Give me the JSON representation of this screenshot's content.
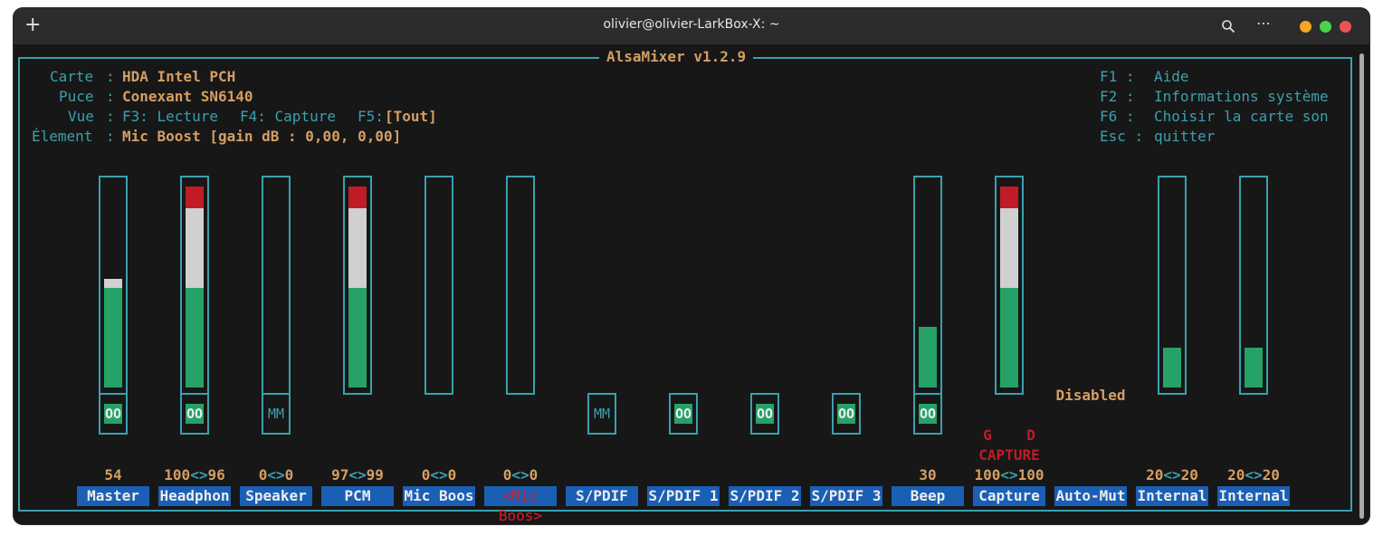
{
  "window": {
    "title": "olivier@olivier-LarkBox-X: ~",
    "traffic_colors": [
      "#f5a623",
      "#4cd34c",
      "#e95353"
    ]
  },
  "app": {
    "title": "AlsaMixer v1.2.9"
  },
  "info": {
    "card_label": "Carte",
    "card_value": "HDA Intel PCH",
    "chip_label": "Puce",
    "chip_value": "Conexant SN6140",
    "view_label": "Vue",
    "view_f3": "F3: Lecture",
    "view_f4": "F4: Capture",
    "view_f5_key": "F5:",
    "view_f5_value": "[Tout]",
    "element_label": "Élement",
    "element_value": "Mic Boost [gain dB : 0,00, 0,00]"
  },
  "help": {
    "f1_key": "F1 :",
    "f1_value": "Aide",
    "f2_key": "F2 :",
    "f2_value": "Informations système",
    "f6_key": "F6 :",
    "f6_value": "Choisir la carte son",
    "esc_key": "Esc :",
    "esc_value": "quitter"
  },
  "channels": [
    {
      "name": "Master",
      "value": "54",
      "level": 0.54,
      "mute": "OO"
    },
    {
      "name": "Headphon",
      "value_left": "100",
      "value_sep": "<>",
      "value_right": "96",
      "level": 1.0,
      "mute": "OO"
    },
    {
      "name": "Speaker",
      "value_left": "0",
      "value_sep": "<>",
      "value_right": "0",
      "level": 0,
      "mute": "MM"
    },
    {
      "name": "PCM",
      "value_left": "97",
      "value_sep": "<>",
      "value_right": "99",
      "level": 1.0
    },
    {
      "name": "Mic Boos",
      "value_left": "0",
      "value_sep": "<>",
      "value_right": "0",
      "level": 0
    },
    {
      "name": "<Mic Boos>",
      "value_left": "0",
      "value_sep": "<>",
      "value_right": "0",
      "level": 0,
      "selected": true
    },
    {
      "name": "S/PDIF",
      "mute": "MM"
    },
    {
      "name": "S/PDIF 1",
      "mute": "OO"
    },
    {
      "name": "S/PDIF 2",
      "mute": "OO"
    },
    {
      "name": "S/PDIF 3",
      "mute": "OO"
    },
    {
      "name": "Beep",
      "value": "30",
      "level": 0.3,
      "mute": "OO"
    },
    {
      "name": "Capture",
      "value_left": "100",
      "value_sep": "<>",
      "value_right": "100",
      "level": 1.0,
      "capture_left": "G",
      "capture_right": "D",
      "capture_label": "CAPTURE"
    },
    {
      "name": "Auto-Mut",
      "enum_value": "Disabled"
    },
    {
      "name": "Internal",
      "value_left": "20",
      "value_sep": "<>",
      "value_right": "20",
      "level": 0.2
    },
    {
      "name": "Internal",
      "value_left": "20",
      "value_sep": "<>",
      "value_right": "20",
      "level": 0.2
    }
  ],
  "colors": {
    "border": "#3aa0ae",
    "accent": "#d59e63",
    "bar_green": "#26a269",
    "bar_white": "#d0d0d0",
    "bar_red": "#c01c28",
    "label_bg": "#1a5fb4",
    "selected_text": "#e01b24"
  }
}
